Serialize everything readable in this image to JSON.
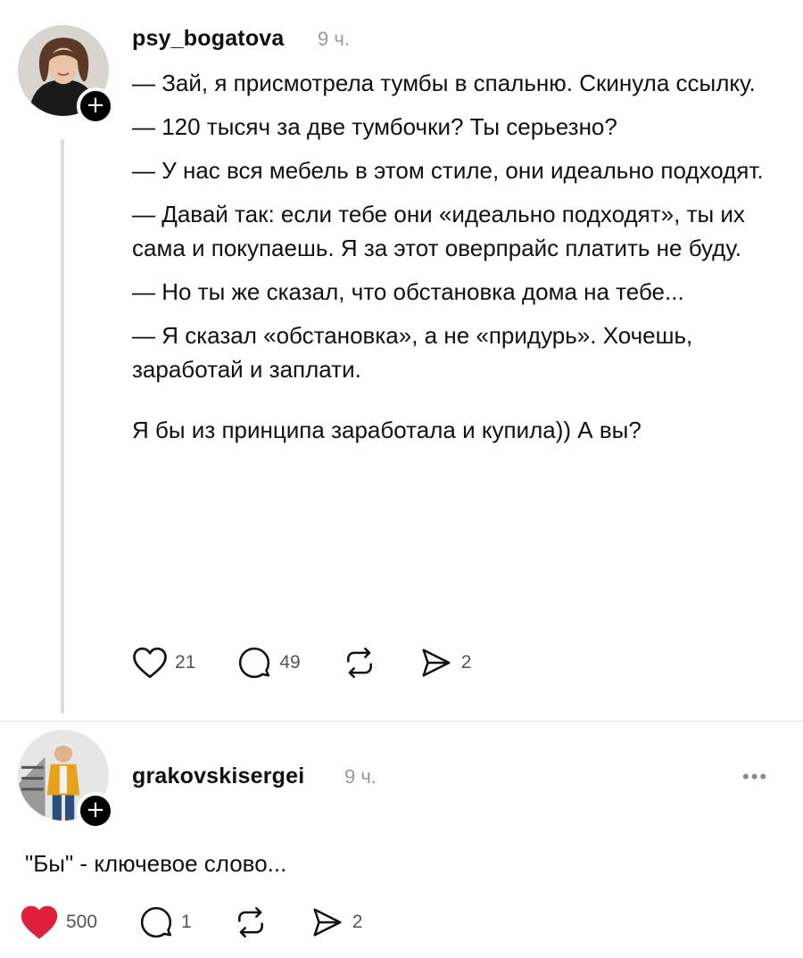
{
  "post": {
    "username": "psy_bogatova",
    "time": "9 ч.",
    "paragraphs": [
      "— Зай, я присмотрела тумбы в спальню. Скинула ссылку.",
      "— 120 тысяч за две тумбочки? Ты серьезно?",
      "— У нас вся мебель в этом стиле, они идеально подходят.",
      "— Давай так: если тебе они «идеально подходят», ты их сама и покупаешь. Я за этот оверпрайс платить не буду.",
      "— Но ты же сказал, что обстановка дома на тебе...",
      "— Я сказал «обстановка», а не «придурь». Хочешь, заработай и заплати.",
      "Я бы из принципа заработала и купила)) А вы?"
    ],
    "actions": {
      "likes": "21",
      "comments": "49",
      "shares": "2"
    }
  },
  "reply": {
    "username": "grakovskisergei",
    "time": "9 ч.",
    "more_label": "•••",
    "text": "\"Бы\" - ключевое слово...",
    "actions": {
      "likes": "500",
      "comments": "1",
      "shares": "2"
    },
    "like_color": "#e0203b"
  },
  "icons": {
    "follow": "+",
    "like": "heart-icon",
    "comment": "comment-bubble-icon",
    "repost": "repost-icon",
    "share": "send-icon"
  }
}
